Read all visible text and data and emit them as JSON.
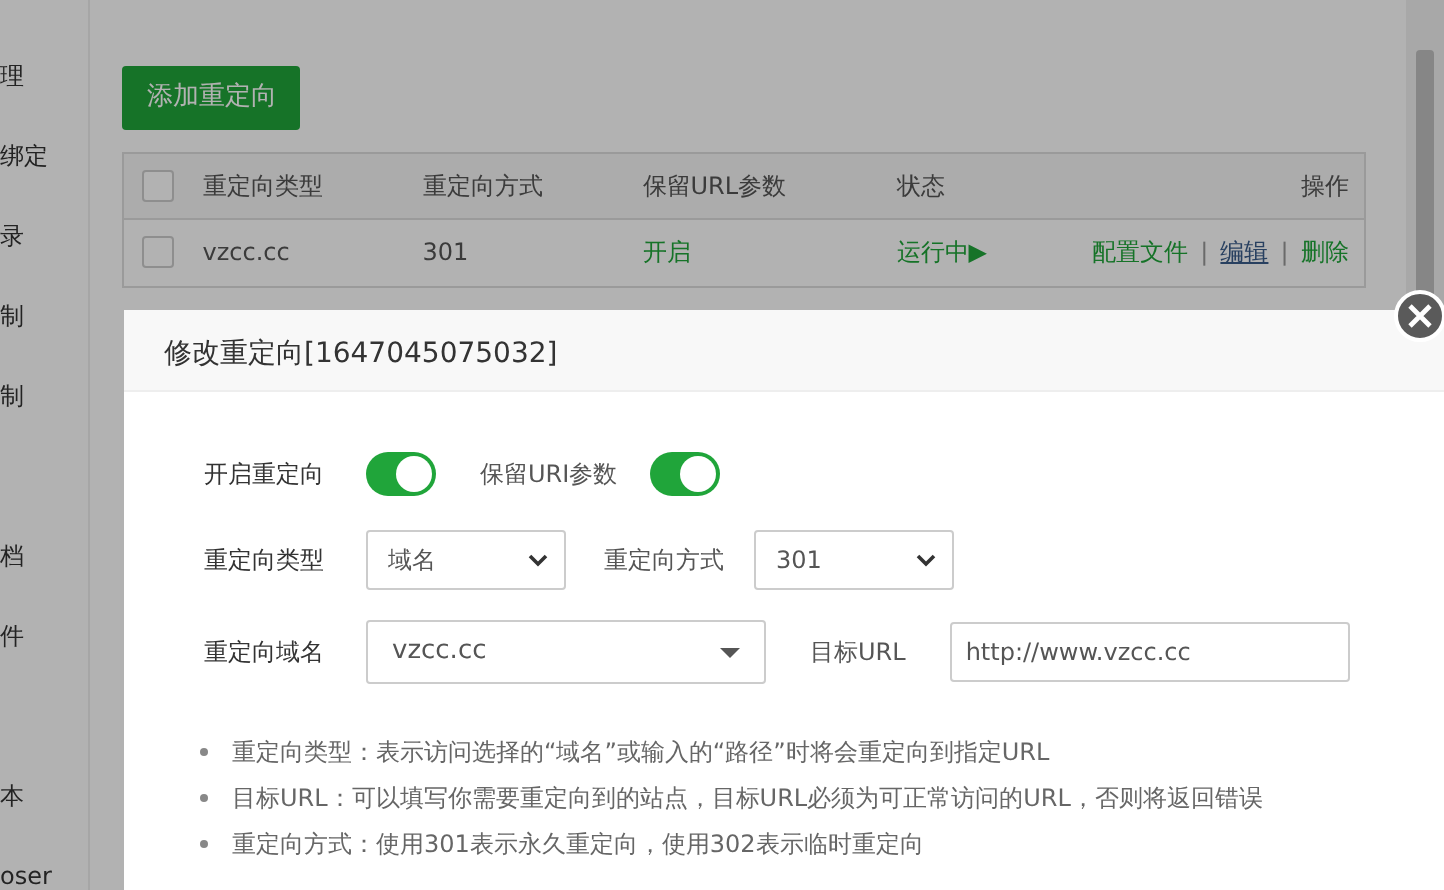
{
  "sidebar": {
    "items": [
      {
        "label": "理"
      },
      {
        "label": "绑定"
      },
      {
        "label": "录"
      },
      {
        "label": "制"
      },
      {
        "label": "制"
      },
      {
        "label": "档"
      },
      {
        "label": "件"
      },
      {
        "label": "本"
      },
      {
        "label": "oser"
      }
    ]
  },
  "main": {
    "add_button": "添加重定向",
    "table": {
      "header_checked": false,
      "action_separator": "|",
      "columns": [
        "重定向类型",
        "重定向方式",
        "保留URL参数",
        "状态",
        "操作"
      ],
      "rows": [
        {
          "checked": false,
          "type": "vzcc.cc",
          "method": "301",
          "keep_params": "开启",
          "status": "运行中▶",
          "actions": [
            "配置文件",
            "编辑",
            "删除"
          ]
        }
      ]
    }
  },
  "dialog": {
    "title": "修改重定向[1647045075032]",
    "enable_redirect": {
      "label": "开启重定向",
      "on": true
    },
    "keep_uri": {
      "label": "保留URI参数",
      "on": true
    },
    "redirect_type": {
      "label": "重定向类型",
      "value": "域名"
    },
    "redirect_method": {
      "label": "重定向方式",
      "value": "301"
    },
    "redirect_domain": {
      "label": "重定向域名",
      "value": "vzcc.cc"
    },
    "target_url": {
      "label": "目标URL",
      "value": "http://www.vzcc.cc"
    },
    "notes": [
      "重定向类型：表示访问选择的“域名”或输入的“路径”时将会重定向到指定URL",
      "目标URL：可以填写你需要重定向到的站点，目标URL必须为可正常访问的URL，否则将返回错误",
      "重定向方式：使用301表示永久重定向，使用302表示临时重定向"
    ]
  }
}
